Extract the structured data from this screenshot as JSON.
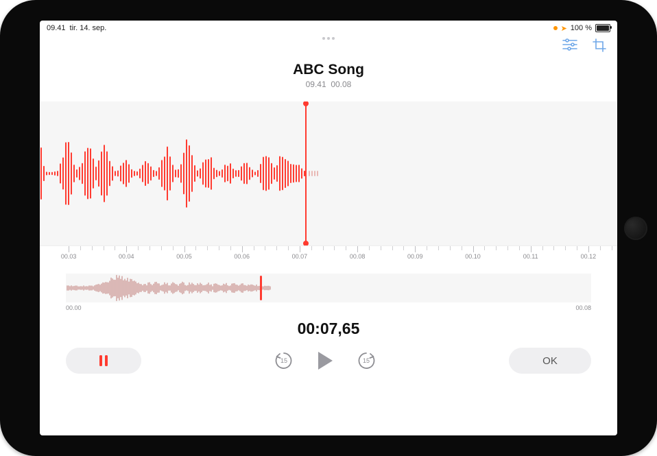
{
  "status": {
    "time": "09.41",
    "date": "tir. 14. sep.",
    "battery_pct": "100 %"
  },
  "toolbar": {
    "options_icon": "options-slider-icon",
    "trim_icon": "crop-icon"
  },
  "header": {
    "title": "ABC Song",
    "time": "09.41",
    "duration": "00.08"
  },
  "ruler": {
    "labels": [
      "00.03",
      "00.04",
      "00.05",
      "00.06",
      "00.07",
      "00.08",
      "00.09",
      "00.10",
      "00.11",
      "00.12"
    ]
  },
  "overview": {
    "start": "00.00",
    "end": "00.08"
  },
  "counter": "00:07,65",
  "controls": {
    "pause_label": "",
    "skip_seconds": "15",
    "ok_label": "OK"
  }
}
